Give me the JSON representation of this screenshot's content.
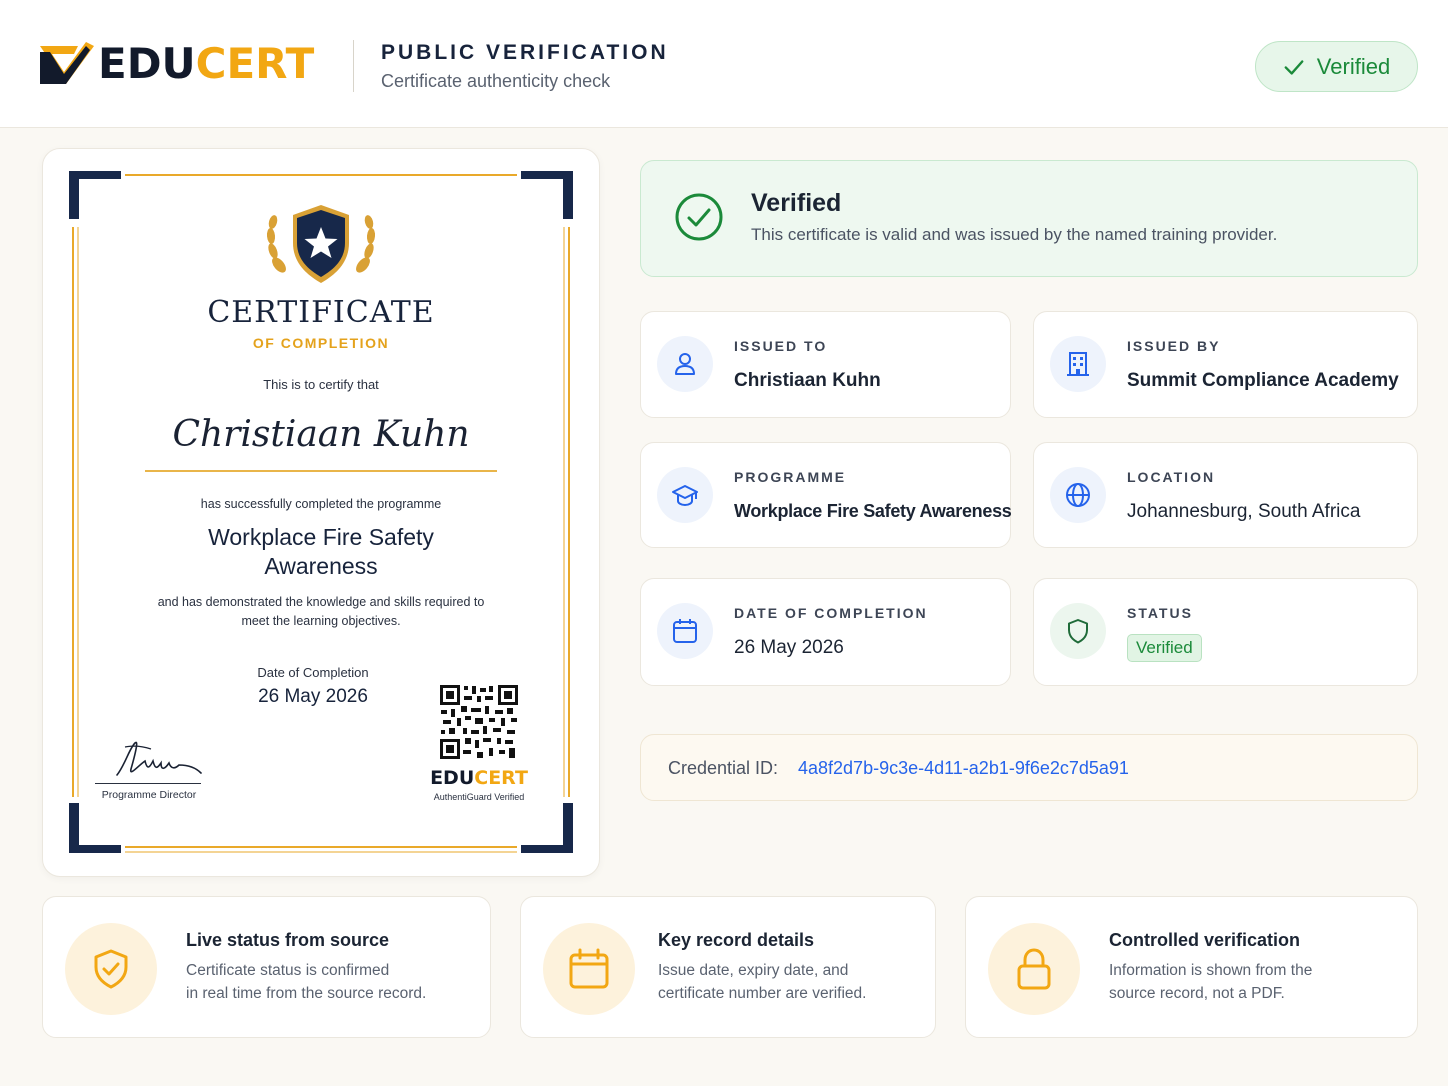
{
  "header": {
    "brand_edu": "EDU",
    "brand_cert": "CERT",
    "title": "PUBLIC VERIFICATION",
    "subtitle": "Certificate authenticity check",
    "status_pill": "Verified"
  },
  "certificate": {
    "heading": "CERTIFICATE",
    "subheading": "OF COMPLETION",
    "intro": "This is to certify that",
    "recipient_name": "Christiaan Kuhn",
    "completed_text": "has successfully completed the programme",
    "programme": "Workplace Fire Safety Awareness",
    "demonstrated_text": "and has demonstrated the knowledge and skills required to meet the learning objectives.",
    "date_label": "Date of Completion",
    "date": "26 May 2026",
    "signature_label": "Programme Director",
    "logo_edu": "EDU",
    "logo_cert": "CERT",
    "logo_sub": "AuthentiGuard Verified"
  },
  "verification": {
    "title": "Verified",
    "text": "This certificate is valid and was issued by the named training provider."
  },
  "details": {
    "issued_to": {
      "label": "ISSUED TO",
      "value": "Christiaan Kuhn"
    },
    "issued_by": {
      "label": "ISSUED BY",
      "value": "Summit Compliance Academy"
    },
    "programme": {
      "label": "PROGRAMME",
      "value": "Workplace Fire Safety Awareness"
    },
    "location": {
      "label": "LOCATION",
      "value": "Johannesburg, South Africa"
    },
    "date_of_completion": {
      "label": "DATE OF COMPLETION",
      "value": "26 May 2026"
    },
    "status": {
      "label": "STATUS",
      "value": "Verified"
    }
  },
  "credential": {
    "label": "Credential ID:",
    "value": "4a8f2d7b-9c3e-4d11-a2b1-9f6e2c7d5a91"
  },
  "features": [
    {
      "title": "Live status from source",
      "text_line1": "Certificate status is confirmed",
      "text_line2": "in real time from the source record.",
      "icon": "shield-check-icon"
    },
    {
      "title": "Key record details",
      "text_line1": "Issue date, expiry date, and",
      "text_line2": "certificate number are verified.",
      "icon": "calendar-icon"
    },
    {
      "title": "Controlled verification",
      "text_line1": "Information is shown from the",
      "text_line2": "source record, not a PDF.",
      "icon": "lock-icon"
    }
  ],
  "colors": {
    "accent_gold": "#f2a713",
    "navy": "#121a2b",
    "verified_green": "#1b8a3a",
    "link_blue": "#2563eb"
  }
}
